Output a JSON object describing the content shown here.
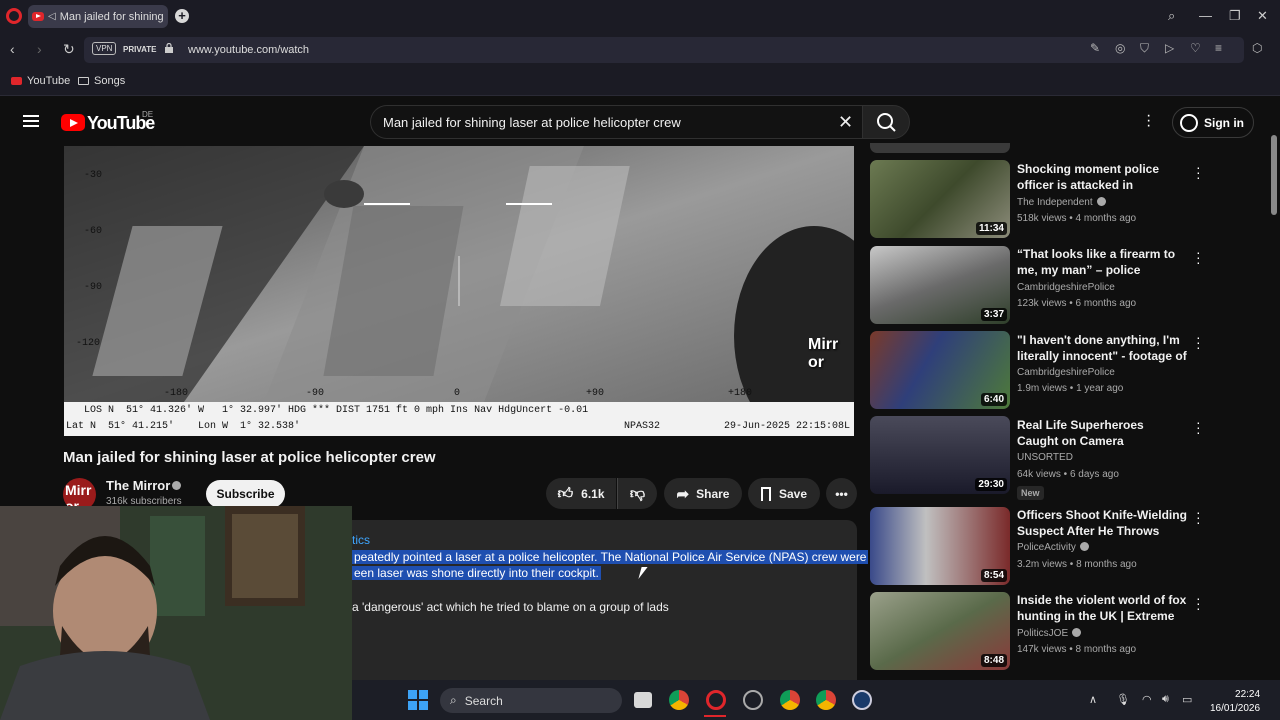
{
  "browser": {
    "tab_title": "Man jailed for shining",
    "url": "www.youtube.com/watch",
    "vpn_label": "VPN",
    "private_label": "PRIVATE",
    "bookmarks": [
      {
        "label": "YouTube",
        "icon": "youtube-icon"
      },
      {
        "label": "Songs",
        "icon": "folder-icon"
      }
    ]
  },
  "youtube": {
    "logo_text": "YouTube",
    "country_code": "DE",
    "search_query": "Man jailed for shining laser at police helicopter crew",
    "signin_label": "Sign in"
  },
  "video": {
    "title": "Man jailed for shining laser at police helicopter crew",
    "channel": "The Mirror",
    "channel_avatar_text": "Mirr or",
    "subscribers": "316k subscribers",
    "subscribe_label": "Subscribe",
    "likes": "6.1k",
    "share_label": "Share",
    "save_label": "Save",
    "overlay": {
      "pitch_ticks": [
        "-30",
        "-60",
        "-90",
        "-120"
      ],
      "heading_ticks": [
        "-180",
        "-90",
        "0",
        "+90",
        "+180"
      ],
      "info_line1": "LOS N  51° 41.326' W   1° 32.997' HDG *** DIST 1751 ft 0 mph Ins Nav HdgUncert -0.01",
      "info_line2": "Lat N  51° 41.215'    Lon W  1° 32.538'",
      "unit": "NPAS32",
      "timestamp": "29-Jun-2025 22:15:08L",
      "watermark": "Mirr or"
    }
  },
  "description": {
    "tag": "tics",
    "highlighted_line1": "peatedly pointed a laser at a police helicopter. The National Police Air Service (NPAS) crew were",
    "highlighted_line2": "een laser was shone directly into their cockpit.",
    "line3": "a 'dangerous' act which he tried to blame on a group of lads"
  },
  "recommendations": [
    {
      "title": "Shocking moment police officer is attacked in crossbow ambush",
      "channel": "The Independent",
      "verified": true,
      "meta": "518k views • 4 months ago",
      "duration": "11:34"
    },
    {
      "title": "“That looks like a firearm to me, my man” – police footage of ...",
      "channel": "CambridgeshirePolice",
      "verified": false,
      "meta": "123k views • 6 months ago",
      "duration": "3:37"
    },
    {
      "title": "\"I haven't done anything, I'm literally innocent\" - footage of ...",
      "channel": "CambridgeshirePolice",
      "verified": false,
      "meta": "1.9m views • 1 year ago",
      "duration": "6:40"
    },
    {
      "title": "Real Life Superheroes Caught on Camera",
      "channel": "UNSORTED",
      "verified": false,
      "meta": "64k views • 6 days ago",
      "duration": "29:30",
      "badge": "New"
    },
    {
      "title": "Officers Shoot Knife-Wielding Suspect After He Throws Wine...",
      "channel": "PoliceActivity",
      "verified": true,
      "meta": "3.2m views • 8 months ago",
      "duration": "8:54"
    },
    {
      "title": "Inside the violent world of fox hunting in the UK | Extreme ...",
      "channel": "PoliticsJOE",
      "verified": true,
      "meta": "147k views • 8 months ago",
      "duration": "8:48"
    }
  ],
  "taskbar": {
    "search_label": "Search",
    "time": "22:24",
    "date": "16/01/2026"
  },
  "colors": {
    "accent_blue": "#3ea6ff",
    "youtube_red": "#ff0000",
    "highlight": "#1f4fb0"
  }
}
